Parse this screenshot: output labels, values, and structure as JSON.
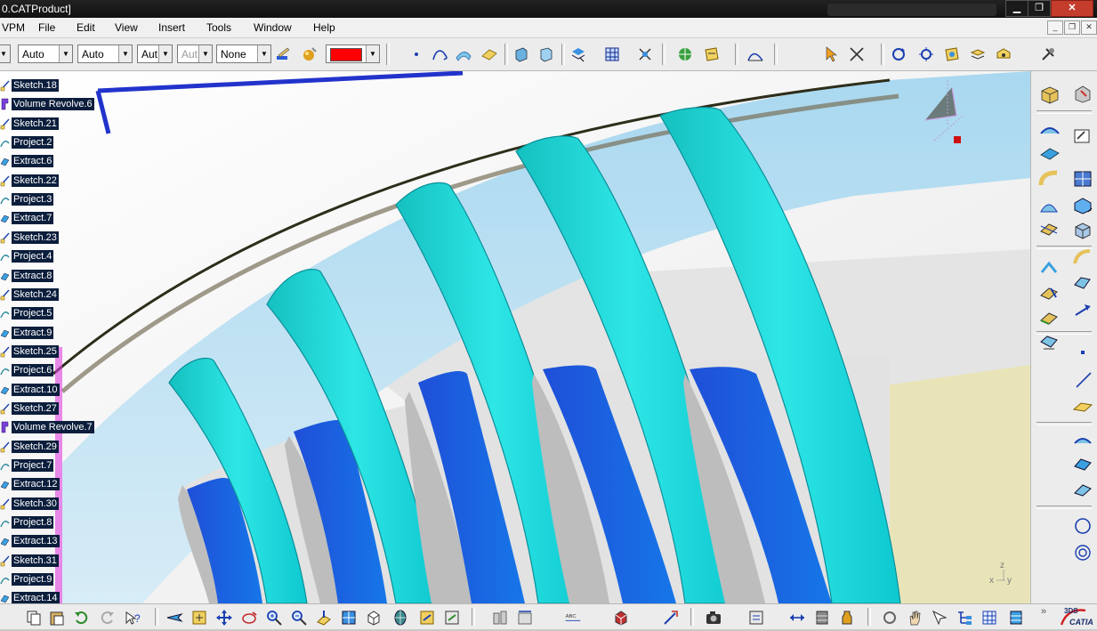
{
  "window": {
    "title": "0.CATProduct]",
    "min_label": "▁",
    "max_label": "❐",
    "close_label": "✕"
  },
  "menu": {
    "items": [
      "VPM",
      "File",
      "Edit",
      "View",
      "Insert",
      "Tools",
      "Window",
      "Help"
    ],
    "mdi_buttons": [
      "_",
      "❐",
      "✕"
    ]
  },
  "toolbar": {
    "combos": [
      {
        "value": "Auto",
        "disabled": false
      },
      {
        "value": "Auto",
        "disabled": false
      },
      {
        "value": "Aut",
        "disabled": false
      },
      {
        "value": "Aut",
        "disabled": true
      },
      {
        "value": "None",
        "disabled": false
      }
    ],
    "color_swatch": "#ff0000"
  },
  "tree": {
    "items": [
      {
        "label": "Sketch.18",
        "icon": "sketch-icon"
      },
      {
        "label": "Volume Revolve.6",
        "icon": "volume-revolve-icon"
      },
      {
        "label": "Sketch.21",
        "icon": "sketch-icon"
      },
      {
        "label": "Project.2",
        "icon": "project-icon"
      },
      {
        "label": "Extract.6",
        "icon": "extract-icon"
      },
      {
        "label": "Sketch.22",
        "icon": "sketch-icon"
      },
      {
        "label": "Project.3",
        "icon": "project-icon"
      },
      {
        "label": "Extract.7",
        "icon": "extract-icon"
      },
      {
        "label": "Sketch.23",
        "icon": "sketch-icon"
      },
      {
        "label": "Project.4",
        "icon": "project-icon"
      },
      {
        "label": "Extract.8",
        "icon": "extract-icon"
      },
      {
        "label": "Sketch.24",
        "icon": "sketch-icon"
      },
      {
        "label": "Project.5",
        "icon": "project-icon"
      },
      {
        "label": "Extract.9",
        "icon": "extract-icon"
      },
      {
        "label": "Sketch.25",
        "icon": "sketch-icon"
      },
      {
        "label": "Project.6",
        "icon": "project-icon"
      },
      {
        "label": "Extract.10",
        "icon": "extract-icon"
      },
      {
        "label": "Sketch.27",
        "icon": "sketch-icon"
      },
      {
        "label": "Volume Revolve.7",
        "icon": "volume-revolve-icon"
      },
      {
        "label": "Sketch.29",
        "icon": "sketch-icon"
      },
      {
        "label": "Project.7",
        "icon": "project-icon"
      },
      {
        "label": "Extract.12",
        "icon": "extract-icon"
      },
      {
        "label": "Sketch.30",
        "icon": "sketch-icon"
      },
      {
        "label": "Project.8",
        "icon": "project-icon"
      },
      {
        "label": "Extract.13",
        "icon": "extract-icon"
      },
      {
        "label": "Sketch.31",
        "icon": "sketch-icon"
      },
      {
        "label": "Project.9",
        "icon": "project-icon"
      },
      {
        "label": "Extract.14",
        "icon": "extract-icon"
      }
    ]
  },
  "viewport": {
    "compass_axes": [
      "X",
      "Y",
      "Z"
    ],
    "axis_labels": {
      "x": "x",
      "y": "y",
      "z": "z"
    }
  },
  "branding": {
    "logo_text": "CATIA",
    "logo_prefix": "3DS"
  },
  "colors": {
    "blade_light": "#20d6d0",
    "blade_dark": "#1565d8",
    "tree_label_bg": "#0b1e3c",
    "titlebar": "#111111"
  }
}
